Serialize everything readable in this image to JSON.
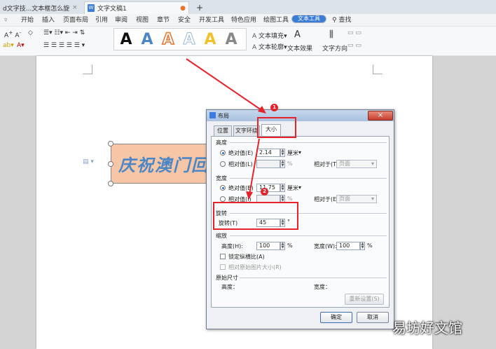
{
  "tabs": [
    {
      "label": "d文字技...文本框怎么旋转",
      "close": "×"
    },
    {
      "label": "文字文稿1",
      "modified_dot": "●"
    }
  ],
  "new_tab": "+",
  "menu": [
    "开始",
    "插入",
    "页面布局",
    "引用",
    "审阅",
    "视图",
    "章节",
    "安全",
    "开发工具",
    "特色应用",
    "绘图工具",
    "文本工具"
  ],
  "menu_selected": "文本工具",
  "search_label": "查找",
  "toolbar": {
    "text_fill": "文本填充",
    "text_outline": "文本轮廓",
    "text_effect": "文本效果",
    "text_direction": "文字方向",
    "style_letter": "A",
    "style_colors": [
      "#111111",
      "#4a86c8",
      "#e8742c",
      "#9bb8d8",
      "#f2c12e",
      "#888888"
    ]
  },
  "textbox": {
    "text": "庆祝澳门回",
    "fill": "#f6c6a6",
    "text_color": "#4d86c4"
  },
  "dialog": {
    "title": "布局",
    "close": "×",
    "tabs": [
      "位置",
      "文字环绕",
      "大小"
    ],
    "active_tab": "大小",
    "height": {
      "section": "高度",
      "absolute_label": "绝对值(E)",
      "absolute_value": "2.14",
      "unit": "厘米",
      "relative_label": "相对值(L)",
      "percent": "%",
      "relative_to": "相对于(T)",
      "relative_to_value": "页面"
    },
    "width": {
      "section": "宽度",
      "absolute_label": "绝对值(B)",
      "absolute_value": "11.75",
      "unit": "厘米",
      "relative_label": "相对值(I)",
      "percent": "%",
      "relative_to": "相对于(E)",
      "relative_to_value": "页面"
    },
    "rotate": {
      "section": "旋转",
      "label": "旋转(T)",
      "value": "45",
      "unit": "°"
    },
    "scale": {
      "section": "缩放",
      "height_label": "高度(H):",
      "height_value": "100",
      "width_label": "宽度(W):",
      "width_value": "100",
      "percent": "%",
      "lock_ratio": "锁定纵横比(A)",
      "relative_original": "相对原始图片大小(R)"
    },
    "original": {
      "section": "原始尺寸",
      "height": "高度：",
      "width": "宽度：",
      "reset": "重新设置(S)"
    },
    "ok": "确定",
    "cancel": "取消"
  },
  "annotations": {
    "badge1": "1",
    "badge2": "2",
    "color": "#e8222a"
  },
  "watermark": "易坊好文馆"
}
